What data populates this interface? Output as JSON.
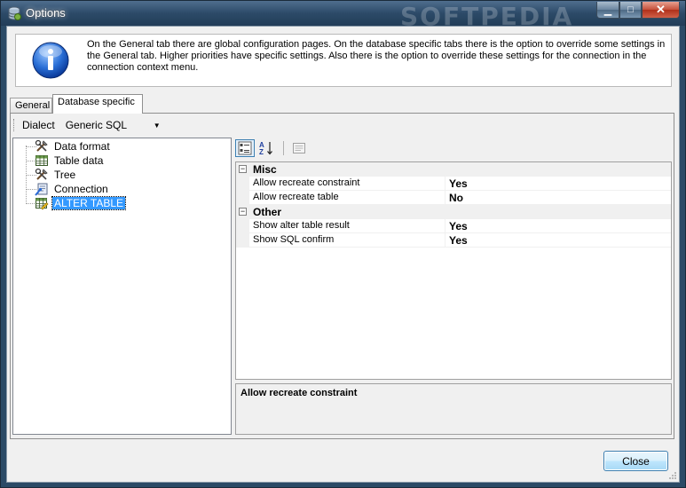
{
  "window": {
    "title": "Options",
    "watermark": "SOFTPEDIA",
    "minimize_glyph": "▁",
    "maximize_glyph": "□",
    "close_glyph": "✕"
  },
  "info": {
    "icon": "info-icon",
    "text": "On the General tab there are global configuration pages. On the database specific tabs there is the option to override some settings in the General tab. Higher priorities have specific settings. Also there is the option to override these settings for the connection in the connection context menu."
  },
  "tabs": [
    {
      "label": "General",
      "active": false
    },
    {
      "label": "Database specific",
      "active": true
    }
  ],
  "dialect": {
    "label": "Dialect",
    "value": "Generic SQL",
    "arrow": "▼"
  },
  "tree": [
    {
      "label": "Data format",
      "icon": "tools-icon"
    },
    {
      "label": "Table data",
      "icon": "table-icon"
    },
    {
      "label": "Tree",
      "icon": "tools-icon"
    },
    {
      "label": "Connection",
      "icon": "connection-icon"
    },
    {
      "label": "ALTER TABLE",
      "icon": "alter-table-icon",
      "selected": true
    }
  ],
  "property_grid": {
    "categories": [
      {
        "name": "Misc",
        "expander": "−",
        "properties": [
          {
            "name": "Allow recreate constraint",
            "value": "Yes"
          },
          {
            "name": "Allow recreate table",
            "value": "No"
          }
        ]
      },
      {
        "name": "Other",
        "expander": "−",
        "properties": [
          {
            "name": "Show alter table result",
            "value": "Yes"
          },
          {
            "name": "Show SQL confirm",
            "value": "Yes"
          }
        ]
      }
    ],
    "description_title": "Allow recreate constraint"
  },
  "buttons": {
    "close": "Close"
  },
  "colors": {
    "selection": "#3399ff",
    "titlebar": "#2c4a68"
  }
}
